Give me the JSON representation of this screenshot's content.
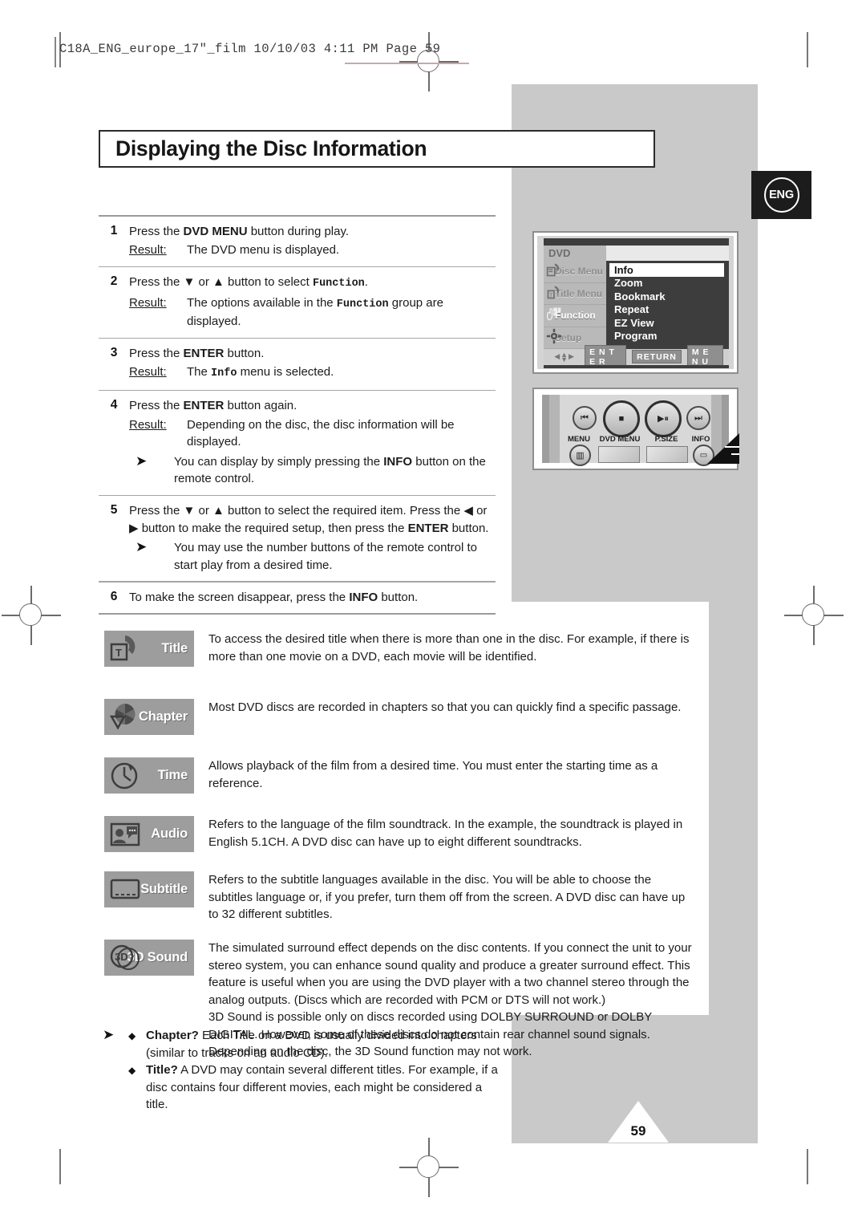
{
  "imprint": {
    "text": "C18A_ENG_europe_17\"_film   10/10/03   4:11 PM   Page 59"
  },
  "title": "Displaying the Disc Information",
  "lang_badge": "ENG",
  "page_number": "59",
  "steps": [
    {
      "num": "1",
      "lines": [
        {
          "type": "instr",
          "parts": [
            {
              "t": "Press the ",
              "b": false
            },
            {
              "t": "DVD MENU",
              "b": true
            },
            {
              "t": " button during play.",
              "b": false
            }
          ]
        },
        {
          "type": "result",
          "label": "Result:",
          "parts": [
            {
              "t": "The DVD menu is displayed.",
              "b": false
            }
          ]
        }
      ]
    },
    {
      "num": "2",
      "lines": [
        {
          "type": "instr",
          "parts": [
            {
              "t": "Press the ▼ or ▲ button to select ",
              "b": false
            },
            {
              "t": "Function",
              "m": true
            },
            {
              "t": ".",
              "b": false
            }
          ]
        },
        {
          "type": "result",
          "label": "Result:",
          "parts": [
            {
              "t": "The options available in the ",
              "b": false
            },
            {
              "t": "Function",
              "m": true
            },
            {
              "t": " group are displayed.",
              "b": false
            }
          ]
        }
      ]
    },
    {
      "num": "3",
      "lines": [
        {
          "type": "instr",
          "parts": [
            {
              "t": "Press the ",
              "b": false
            },
            {
              "t": "ENTER",
              "b": true
            },
            {
              "t": " button.",
              "b": false
            }
          ]
        },
        {
          "type": "result",
          "label": "Result:",
          "parts": [
            {
              "t": "The ",
              "b": false
            },
            {
              "t": "Info",
              "m": true
            },
            {
              "t": " menu is selected.",
              "b": false
            }
          ]
        }
      ]
    },
    {
      "num": "4",
      "lines": [
        {
          "type": "instr",
          "parts": [
            {
              "t": "Press the ",
              "b": false
            },
            {
              "t": "ENTER",
              "b": true
            },
            {
              "t": " button again.",
              "b": false
            }
          ]
        },
        {
          "type": "result",
          "label": "Result:",
          "parts": [
            {
              "t": "Depending on the disc, the disc information will be displayed.",
              "b": false
            }
          ]
        },
        {
          "type": "note",
          "parts": [
            {
              "t": "You can display by simply pressing the ",
              "b": false
            },
            {
              "t": "INFO",
              "b": true
            },
            {
              "t": " button on the remote control.",
              "b": false
            }
          ]
        }
      ]
    },
    {
      "num": "5",
      "lines": [
        {
          "type": "instr",
          "parts": [
            {
              "t": "Press the ▼ or ▲ button to select the required item. Press the ◀ or ▶ button to make the required setup, then press the ",
              "b": false
            },
            {
              "t": "ENTER",
              "b": true
            },
            {
              "t": " button.",
              "b": false
            }
          ]
        },
        {
          "type": "note",
          "parts": [
            {
              "t": "You may use the number buttons of the remote control to start play from a desired time.",
              "b": false
            }
          ]
        }
      ]
    },
    {
      "num": "6",
      "lines": [
        {
          "type": "instr",
          "parts": [
            {
              "t": "To make the screen disappear, press the ",
              "b": false
            },
            {
              "t": "INFO",
              "b": true
            },
            {
              "t": " button.",
              "b": false
            }
          ]
        }
      ]
    }
  ],
  "osd": {
    "title": "DVD",
    "sidebar": [
      {
        "label": "Disc Menu",
        "icon": "disc-menu-icon",
        "selected": false
      },
      {
        "label": "Title Menu",
        "icon": "title-menu-icon",
        "selected": false
      },
      {
        "label": "Function",
        "icon": "function-icon",
        "selected": true
      },
      {
        "label": "Setup",
        "icon": "setup-gear-icon",
        "selected": false
      }
    ],
    "items": [
      {
        "label": "Info",
        "selected": true
      },
      {
        "label": "Zoom",
        "selected": false
      },
      {
        "label": "Bookmark",
        "selected": false
      },
      {
        "label": "Repeat",
        "selected": false
      },
      {
        "label": "EZ View",
        "selected": false
      },
      {
        "label": "Program",
        "selected": false
      }
    ],
    "keys": [
      "E N T E R",
      "RETURN",
      "M E N U"
    ]
  },
  "remote": {
    "labels": [
      "MENU",
      "DVD MENU",
      "P.SIZE",
      "INFO"
    ],
    "transport": [
      "prev-track-icon",
      "stop-icon",
      "play-pause-icon",
      "next-track-icon"
    ],
    "pointer_target": "INFO"
  },
  "features": [
    {
      "label": "Title",
      "icon": "title-badge-icon",
      "text": "To access the desired title when there is more than one in the disc. For example, if there is more than one movie on a DVD, each movie will be identified."
    },
    {
      "label": "Chapter",
      "icon": "chapter-badge-icon",
      "text": "Most DVD discs are recorded in chapters so that you can quickly find a specific passage."
    },
    {
      "label": "Time",
      "icon": "time-badge-icon",
      "text": "Allows playback of the film from a desired time. You must enter the starting time as a reference."
    },
    {
      "label": "Audio",
      "icon": "audio-badge-icon",
      "text": "Refers to the language of the film soundtrack. In the example, the soundtrack is played in English 5.1CH. A DVD disc can have up to eight different soundtracks."
    },
    {
      "label": "Subtitle",
      "icon": "subtitle-badge-icon",
      "text": "Refers to the subtitle languages available in the disc. You will be able to choose the subtitles language or, if you prefer, turn them off from the screen. A DVD disc can have up to 32 different subtitles."
    },
    {
      "label": "3D Sound",
      "icon": "3d-sound-badge-icon",
      "text": "The simulated surround effect depends on the disc contents. If you connect the unit to your stereo system, you can enhance sound quality and produce a greater surround effect. This feature is useful when you are using the DVD player with a two channel stereo through the analog outputs. (Discs which are recorded with PCM or DTS will not work.)\n3D Sound is possible only on discs recorded using DOLBY SURROUND or DOLBY DIGITAL. However, some of these discs do not contain rear channel sound signals. Depending on the disc, the 3D Sound function may not work."
    }
  ],
  "bottom_notes": [
    {
      "term": "Chapter?",
      "text": " Each Title on a DVD is usually divided into chapters (similar to tracks on an audio CD)."
    },
    {
      "term": "Title?",
      "text": " A DVD may contain several different titles. For example, if a disc contains four different movies, each might be considered a title."
    }
  ],
  "colors": {
    "grey_panel": "#c9c9c9",
    "badge_grey": "#9d9d9d",
    "osd_dark": "#3d3d3d",
    "ink": "#1b1b1b"
  }
}
